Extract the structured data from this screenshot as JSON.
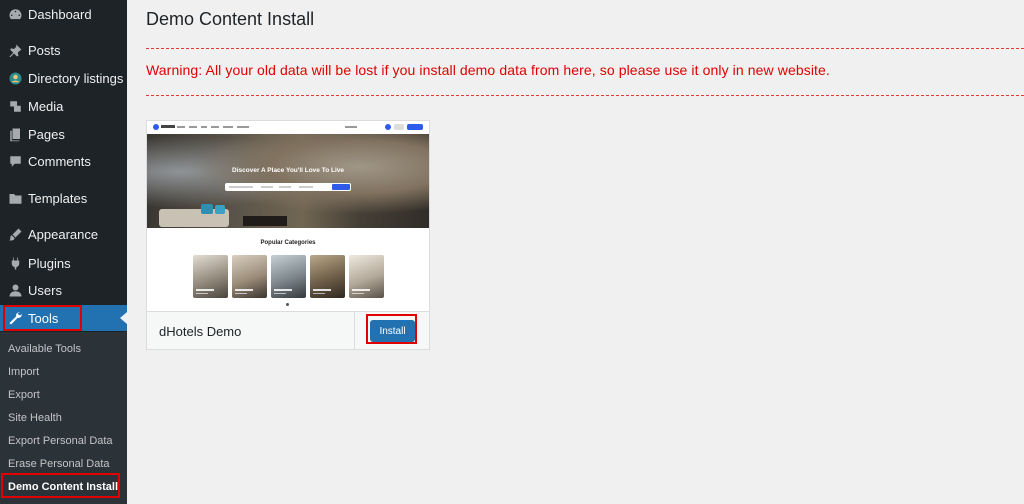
{
  "sidebar": {
    "items": [
      {
        "label": "Dashboard",
        "icon": "dashboard-icon"
      },
      {
        "label": "Posts",
        "icon": "pin-icon"
      },
      {
        "label": "Directory listings",
        "icon": "directory-icon"
      },
      {
        "label": "Media",
        "icon": "media-icon"
      },
      {
        "label": "Pages",
        "icon": "pages-icon"
      },
      {
        "label": "Comments",
        "icon": "comment-icon"
      },
      {
        "label": "Templates",
        "icon": "folder-icon"
      },
      {
        "label": "Appearance",
        "icon": "brush-icon"
      },
      {
        "label": "Plugins",
        "icon": "plug-icon"
      },
      {
        "label": "Users",
        "icon": "user-icon"
      },
      {
        "label": "Tools",
        "icon": "wrench-icon"
      }
    ],
    "active": "Tools",
    "submenu": [
      {
        "label": "Available Tools"
      },
      {
        "label": "Import"
      },
      {
        "label": "Export"
      },
      {
        "label": "Site Health"
      },
      {
        "label": "Export Personal Data"
      },
      {
        "label": "Erase Personal Data"
      },
      {
        "label": "Demo Content Install"
      }
    ],
    "current_submenu": "Demo Content Install"
  },
  "main": {
    "title": "Demo Content Install",
    "warning": "Warning: All your old data will be lost if you install demo data from here, so please use it only in new website.",
    "demo": {
      "name": "dHotels Demo",
      "install_label": "Install",
      "preview": {
        "hero_title": "Discover A Place You'll Love To Live",
        "categories_title": "Popular Categories"
      }
    }
  },
  "colors": {
    "sidebar_bg": "#1d2327",
    "submenu_bg": "#2c3338",
    "active_blue": "#2271b1",
    "warning_red": "#e00000",
    "highlight_red": "#e00000"
  }
}
